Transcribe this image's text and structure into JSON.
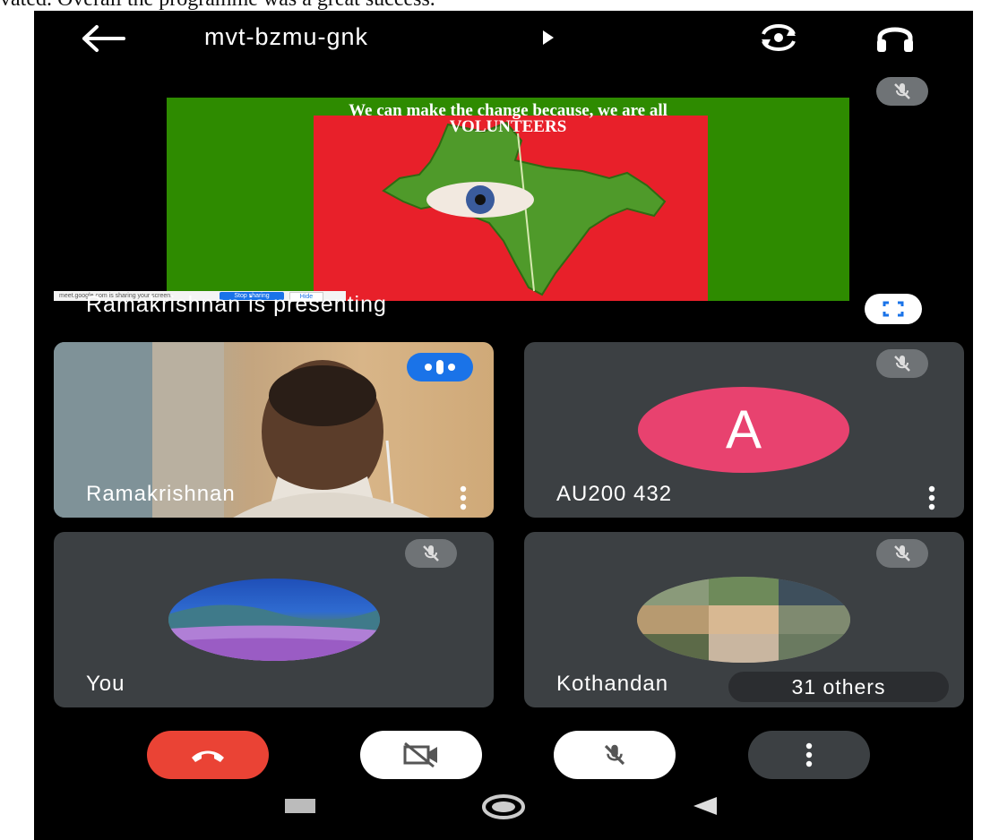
{
  "document": {
    "caption_text": "vated. Overall the programme was a great success."
  },
  "topbar": {
    "meeting_code": "mvt-bzmu-gnk"
  },
  "presentation": {
    "slide_title_line1": "We can make the change because, we are all",
    "slide_title_line2": "VOLUNTEERS",
    "share_notice": "meet.google.com is sharing your screen.",
    "share_stop_label": "Stop sharing",
    "share_hide_label": "Hide",
    "presenting_label": "Ramakrishnan is presenting"
  },
  "participants": [
    {
      "name": "Ramakrishnan",
      "video": true,
      "speaking": true
    },
    {
      "name": "AU200 432",
      "avatar_letter": "A",
      "avatar_color": "#e8426f",
      "muted": true
    },
    {
      "name": "You",
      "muted": true
    },
    {
      "name": "Kothandan",
      "muted": true,
      "others_label": "31 others"
    }
  ],
  "colors": {
    "background": "#000000",
    "tile": "#3c4043",
    "end_call": "#ea4335",
    "speaking_badge": "#1a73e8",
    "control_light": "#ffffff",
    "control_dark": "#3c4043"
  },
  "icons": [
    "back-arrow-icon",
    "caret-right-icon",
    "switch-camera-icon",
    "headphones-icon",
    "mic-off-icon",
    "fullscreen-icon",
    "speaking-icon",
    "more-vert-icon",
    "call-end-icon",
    "camera-off-icon",
    "nav-square-icon",
    "nav-circle-icon",
    "nav-back-icon"
  ]
}
